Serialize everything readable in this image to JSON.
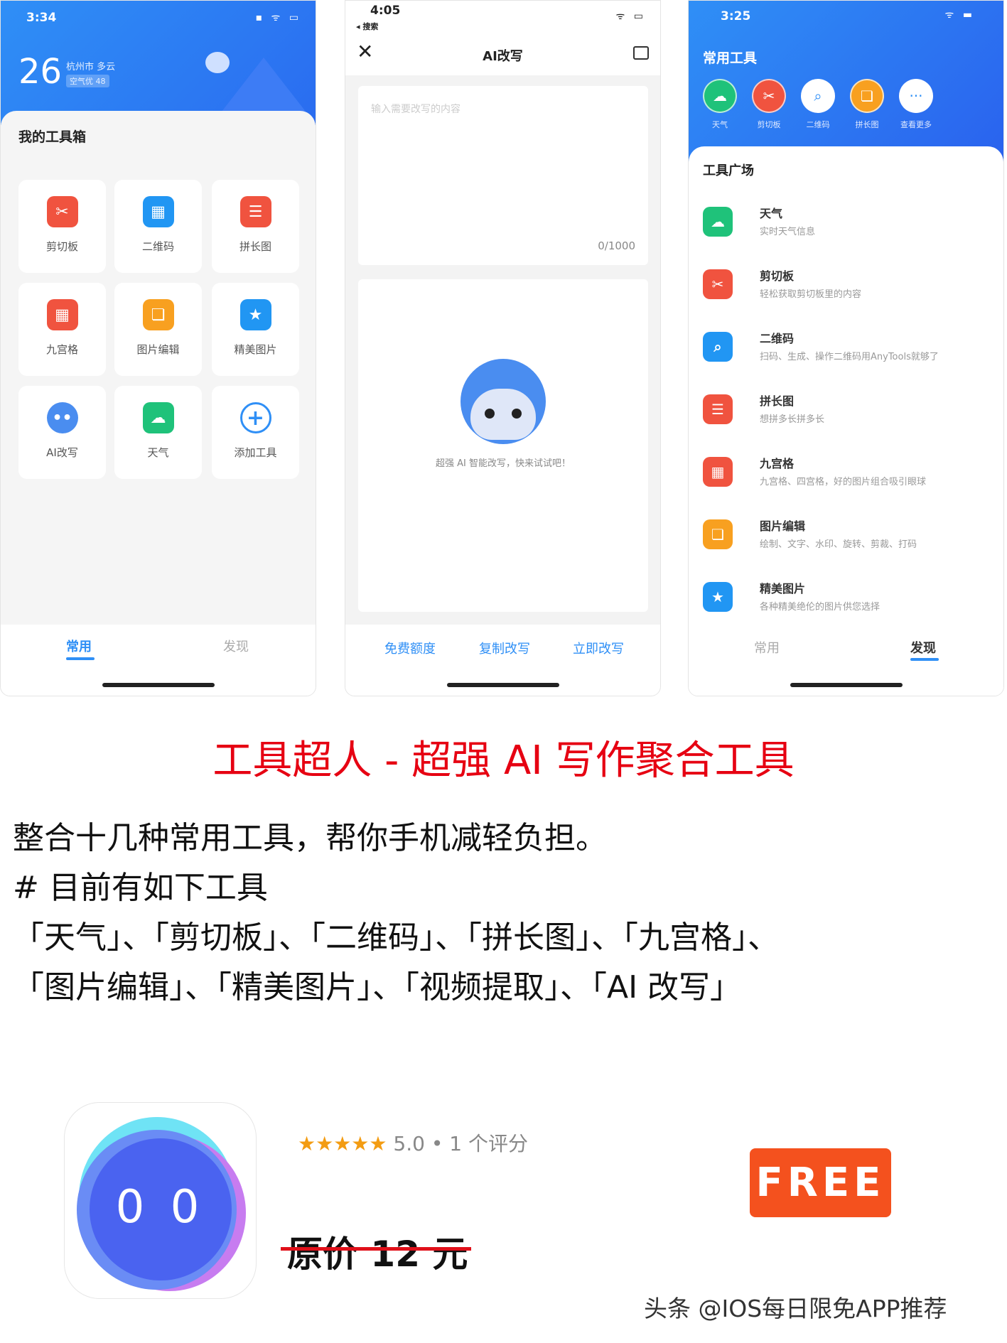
{
  "colors": {
    "accent_blue": "#2f8ff6",
    "title_red": "#e60012",
    "free_bg": "#f4511e",
    "strike_red": "#e0101a",
    "star": "#f39c12"
  },
  "phone1": {
    "status_time": "3:34",
    "temperature": "26",
    "location": "杭州市 多云",
    "air_quality": "空气优 48",
    "section_title": "我的工具箱",
    "tools": [
      {
        "label": "剪切板",
        "icon": "scissors-icon",
        "color": "#f0533f",
        "glyph": "✂"
      },
      {
        "label": "二维码",
        "icon": "qrcode-icon",
        "color": "#2196f3",
        "glyph": "▦"
      },
      {
        "label": "拼长图",
        "icon": "long-image-icon",
        "color": "#f0533f",
        "glyph": "☰"
      },
      {
        "label": "九宫格",
        "icon": "grid-icon",
        "color": "#f0533f",
        "glyph": "▦"
      },
      {
        "label": "图片编辑",
        "icon": "image-edit-icon",
        "color": "#f8a020",
        "glyph": "❏"
      },
      {
        "label": "精美图片",
        "icon": "star-icon",
        "color": "#2196f3",
        "glyph": "★"
      },
      {
        "label": "AI改写",
        "icon": "robot-icon",
        "color": "#4a8df0",
        "glyph": "••"
      },
      {
        "label": "天气",
        "icon": "cloud-icon",
        "color": "#1fc27a",
        "glyph": "☁"
      },
      {
        "label": "添加工具",
        "icon": "plus-circle-icon",
        "color": "#2f8ff6",
        "glyph": "+"
      }
    ],
    "tabs": [
      "常用",
      "发现"
    ],
    "active_tab": "常用"
  },
  "phone2": {
    "status_time": "4:05",
    "back_label": "◂ 搜索",
    "title": "AI改写",
    "input_placeholder": "输入需要改写的内容",
    "counter": "0/1000",
    "hint": "超强 AI 智能改写，快来试试吧！",
    "buttons": [
      "免费额度",
      "复制改写",
      "立即改写"
    ]
  },
  "phone3": {
    "status_time": "3:25",
    "common_title": "常用工具",
    "quick_tools": [
      {
        "label": "天气",
        "color": "#1fc27a",
        "glyph": "☁"
      },
      {
        "label": "剪切板",
        "color": "#f0533f",
        "glyph": "✂"
      },
      {
        "label": "二维码",
        "color": "#ffffff",
        "glyph": "⌕"
      },
      {
        "label": "拼长图",
        "color": "#f8a020",
        "glyph": "❏"
      },
      {
        "label": "查看更多",
        "color": "#ffffff",
        "glyph": "···"
      }
    ],
    "plaza_title": "工具广场",
    "list": [
      {
        "title": "天气",
        "desc": "实时天气信息",
        "color": "#1fc27a",
        "glyph": "☁"
      },
      {
        "title": "剪切板",
        "desc": "轻松获取剪切板里的内容",
        "color": "#f0533f",
        "glyph": "✂"
      },
      {
        "title": "二维码",
        "desc": "扫码、生成、操作二维码用AnyTools就够了",
        "color": "#2196f3",
        "glyph": "⌕"
      },
      {
        "title": "拼长图",
        "desc": "想拼多长拼多长",
        "color": "#f0533f",
        "glyph": "☰"
      },
      {
        "title": "九宫格",
        "desc": "九宫格、四宫格，好的图片组合吸引眼球",
        "color": "#f0533f",
        "glyph": "▦"
      },
      {
        "title": "图片编辑",
        "desc": "绘制、文字、水印、旋转、剪裁、打码",
        "color": "#f8a020",
        "glyph": "❏"
      },
      {
        "title": "精美图片",
        "desc": "各种精美绝伦的图片供您选择",
        "color": "#2196f3",
        "glyph": "★"
      }
    ],
    "tabs": [
      "常用",
      "发现"
    ],
    "active_tab": "发现"
  },
  "headline": "工具超人 - 超强 AI 写作聚合工具",
  "body_lines": [
    "整合十几种常用工具，帮你手机减轻负担。",
    "# 目前有如下工具",
    "「天气」、「剪切板」、「二维码」、「拼长图」、「九宫格」、",
    "「图片编辑」、「精美图片」、「视频提取」、「AI 改写」"
  ],
  "app": {
    "icon_text": "0 0",
    "stars": "★★★★★",
    "rating": 5.0,
    "rating_text": "5.0 • 1 个评分",
    "original_price": "原价 12 元",
    "price_badge": "FREE"
  },
  "watermark": "头条 @IOS每日限免APP推荐"
}
